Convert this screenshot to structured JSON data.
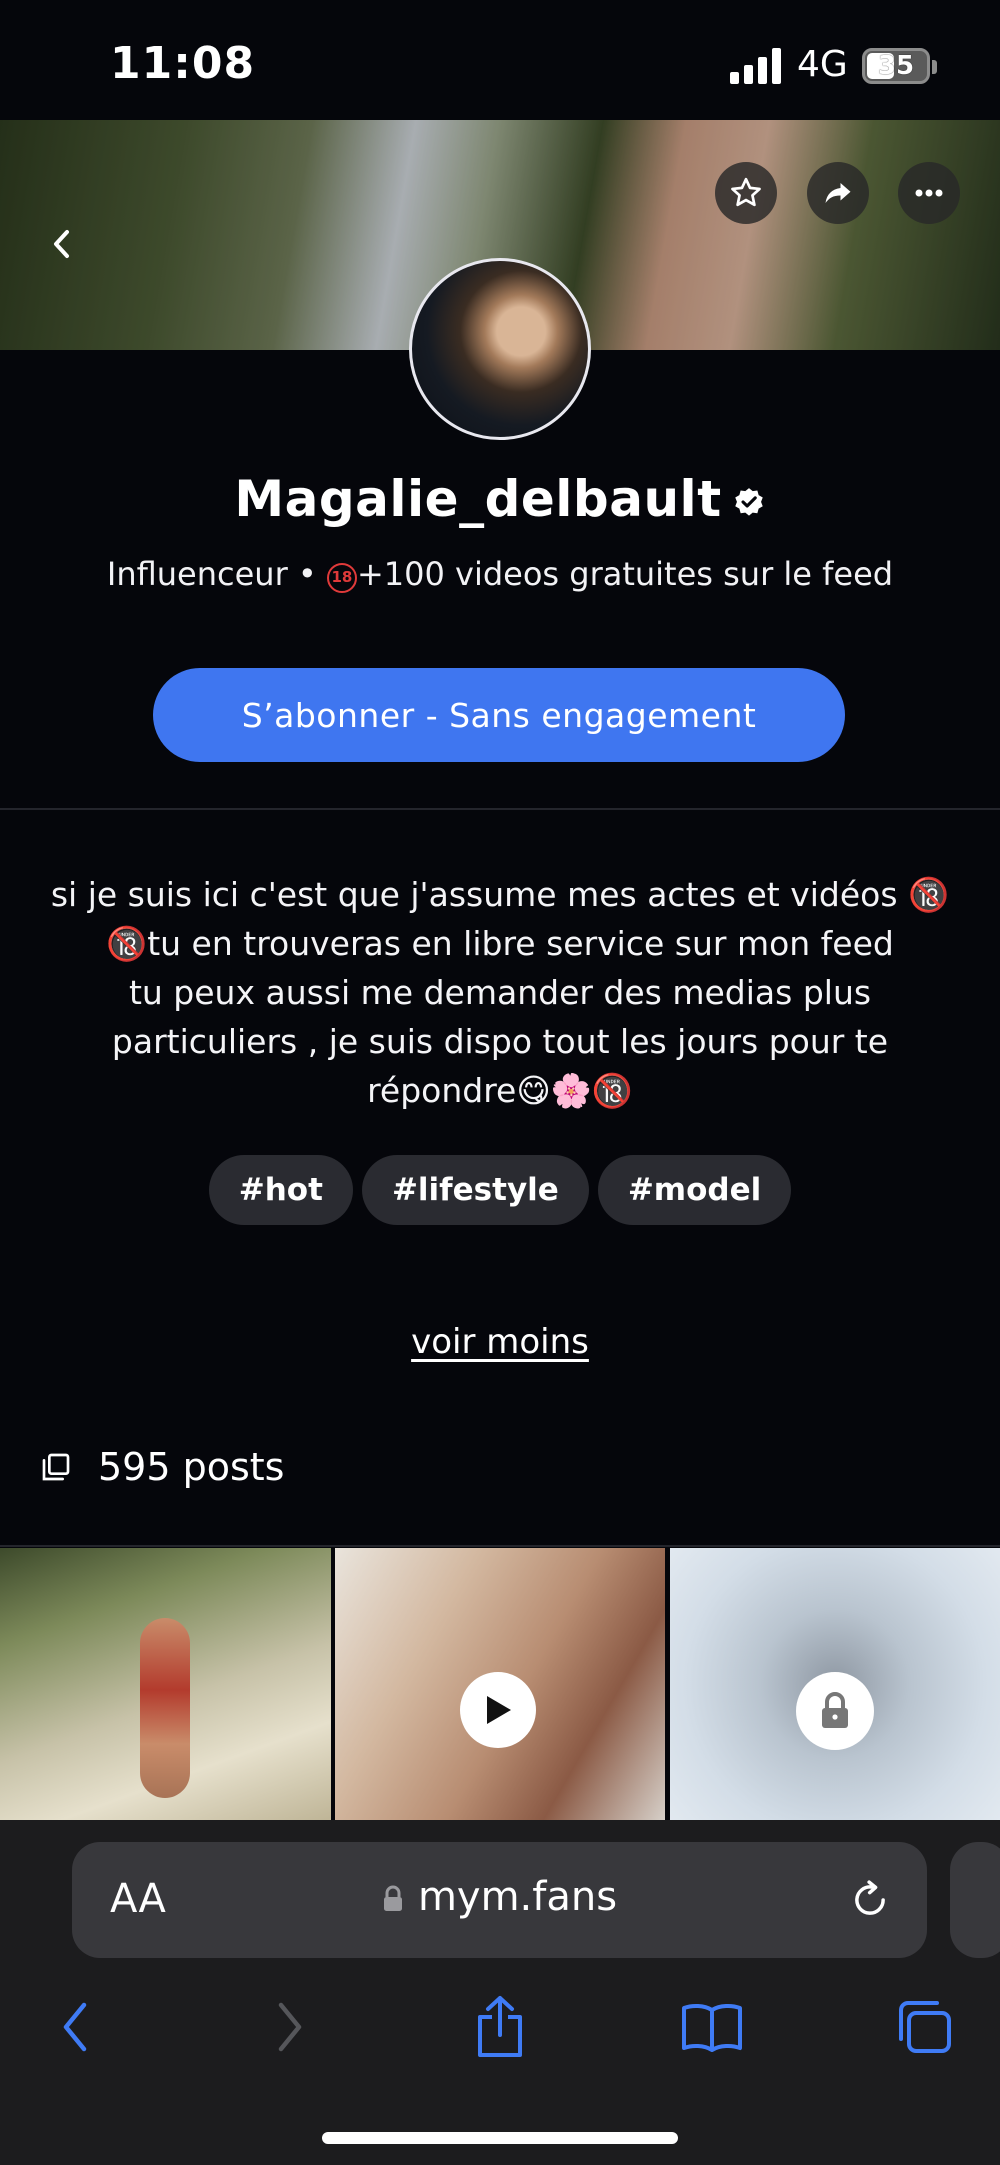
{
  "status_bar": {
    "time": "11:08",
    "network": "4G",
    "battery": "35"
  },
  "profile": {
    "username": "Magalie_delbault",
    "subtitle_prefix": "Influenceur • ",
    "subtitle_badge": "18",
    "subtitle_suffix": "+100 videos gratuites sur le feed",
    "subscribe_label": "S’abonner - Sans engagement"
  },
  "bio": {
    "line1": "si je suis ici c'est que j'assume mes actes et vidéos 🔞",
    "line2": "🔞tu en trouveras en libre service sur mon feed",
    "line3": "tu peux aussi me demander des medias plus",
    "line4": "particuliers , je suis dispo tout les jours pour te",
    "line5": "répondre😋🌸🔞"
  },
  "tags": [
    "#hot",
    "#lifestyle",
    "#model"
  ],
  "voir_moins": "voir moins",
  "posts_count_label": "595 posts",
  "browser": {
    "text_size_label": "AA",
    "url": "mym.fans"
  },
  "icons": {
    "back": "chevron-left-icon",
    "favorite": "star-icon",
    "share": "share-arrow-icon",
    "more": "more-dots-icon",
    "verified": "verified-badge-icon",
    "posts": "posts-stack-icon",
    "play": "play-icon",
    "lock": "lock-icon"
  },
  "colors": {
    "accent": "#3f76f0",
    "background": "#05060b",
    "tag_bg": "#2a2b31",
    "browser_bar": "#1c1c1e"
  }
}
